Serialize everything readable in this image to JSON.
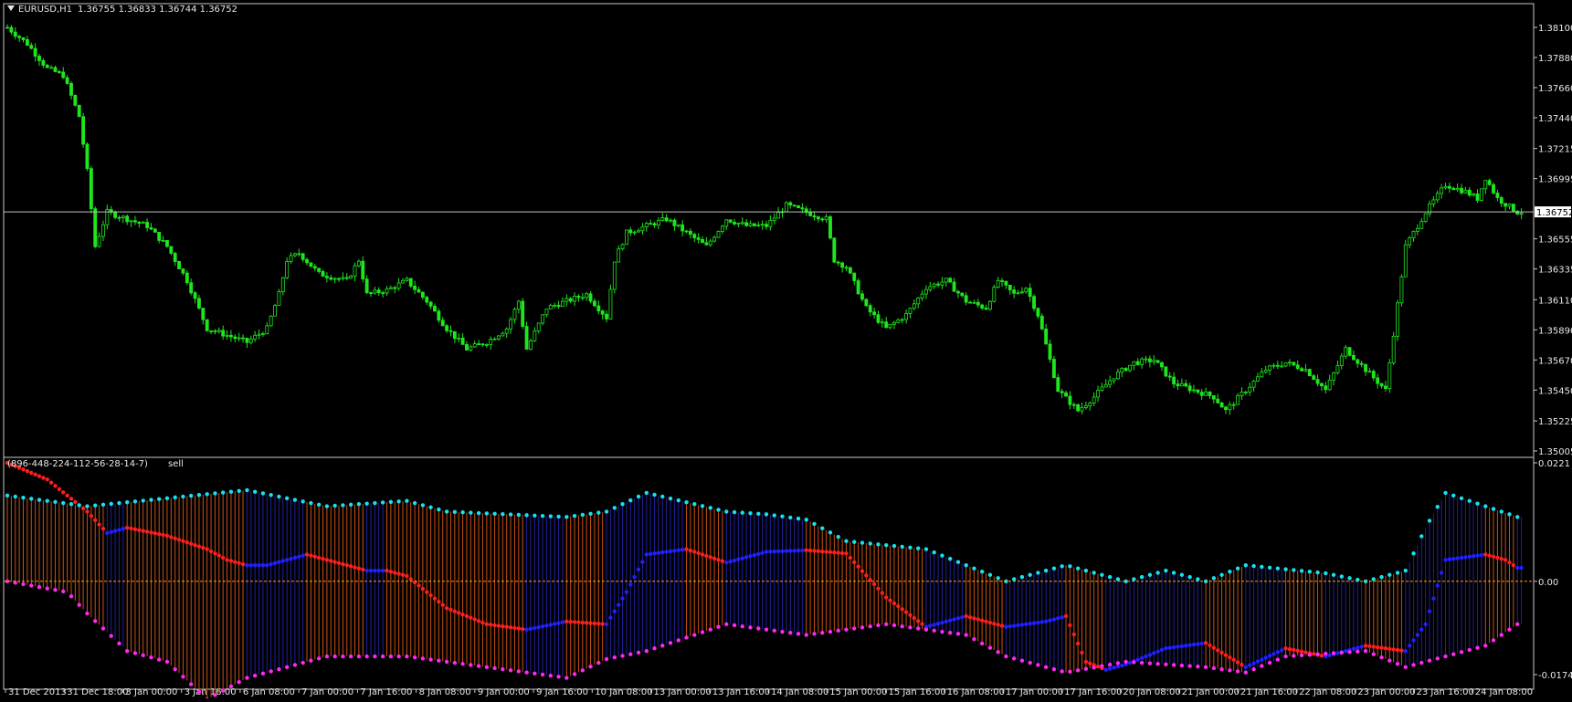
{
  "header": {
    "symbol": "EURUSD,H1",
    "open": "1.36755",
    "high": "1.36833",
    "low": "1.36744",
    "close": "1.36752"
  },
  "indicator": {
    "params": "(896-448-224-112-56-28-14-7)",
    "signal": "sell"
  },
  "colors": {
    "background": "#000000",
    "candle": "#1ee61e",
    "bid_line": "#c0c0c0",
    "zero_line": "#ffa000",
    "red": "#ff1e1e",
    "blue": "#2020ff",
    "cyan": "#18e0f0",
    "magenta": "#ff28f0",
    "hist_red": "#c85014",
    "hist_blue": "#2020a0"
  },
  "chart_data": [
    {
      "type": "candlestick",
      "symbol": "EURUSD",
      "timeframe": "H1",
      "y_ticks": [
        "1.38100",
        "1.37880",
        "1.37660",
        "1.37440",
        "1.37215",
        "1.36995",
        "1.36555",
        "1.36335",
        "1.36110",
        "1.35890",
        "1.35670",
        "1.35450",
        "1.35225",
        "1.35005"
      ],
      "ylim": [
        1.35005,
        1.381
      ],
      "last_price": "1.36752",
      "x_ticks": [
        "31 Dec 2013",
        "31 Dec 18:00",
        "3 Jan 00:00",
        "3 Jan 16:00",
        "6 Jan 08:00",
        "7 Jan 00:00",
        "7 Jan 16:00",
        "8 Jan 08:00",
        "9 Jan 00:00",
        "9 Jan 16:00",
        "10 Jan 08:00",
        "13 Jan 00:00",
        "13 Jan 16:00",
        "14 Jan 08:00",
        "15 Jan 00:00",
        "15 Jan 16:00",
        "16 Jan 08:00",
        "17 Jan 00:00",
        "17 Jan 16:00",
        "20 Jan 08:00",
        "21 Jan 00:00",
        "21 Jan 16:00",
        "22 Jan 08:00",
        "23 Jan 00:00",
        "23 Jan 16:00",
        "24 Jan 08:00"
      ],
      "close_path": [
        [
          0,
          1.381
        ],
        [
          5,
          1.3798
        ],
        [
          10,
          1.378
        ],
        [
          14,
          1.3775
        ],
        [
          18,
          1.3745
        ],
        [
          20,
          1.3705
        ],
        [
          22,
          1.365
        ],
        [
          25,
          1.3675
        ],
        [
          30,
          1.367
        ],
        [
          35,
          1.3665
        ],
        [
          40,
          1.365
        ],
        [
          45,
          1.3625
        ],
        [
          50,
          1.359
        ],
        [
          55,
          1.3585
        ],
        [
          60,
          1.358
        ],
        [
          65,
          1.359
        ],
        [
          68,
          1.3615
        ],
        [
          70,
          1.364
        ],
        [
          73,
          1.3645
        ],
        [
          78,
          1.363
        ],
        [
          85,
          1.3625
        ],
        [
          88,
          1.364
        ],
        [
          90,
          1.3615
        ],
        [
          95,
          1.3618
        ],
        [
          100,
          1.3625
        ],
        [
          105,
          1.361
        ],
        [
          110,
          1.359
        ],
        [
          115,
          1.3575
        ],
        [
          120,
          1.358
        ],
        [
          125,
          1.359
        ],
        [
          128,
          1.361
        ],
        [
          130,
          1.3575
        ],
        [
          135,
          1.3605
        ],
        [
          140,
          1.361
        ],
        [
          145,
          1.3615
        ],
        [
          150,
          1.3598
        ],
        [
          152,
          1.364
        ],
        [
          155,
          1.366
        ],
        [
          160,
          1.3665
        ],
        [
          165,
          1.367
        ],
        [
          170,
          1.366
        ],
        [
          175,
          1.365
        ],
        [
          180,
          1.367
        ],
        [
          185,
          1.3665
        ],
        [
          190,
          1.3665
        ],
        [
          195,
          1.368
        ],
        [
          200,
          1.3675
        ],
        [
          205,
          1.367
        ],
        [
          207,
          1.364
        ],
        [
          210,
          1.3635
        ],
        [
          215,
          1.3605
        ],
        [
          220,
          1.359
        ],
        [
          225,
          1.36
        ],
        [
          230,
          1.362
        ],
        [
          235,
          1.3625
        ],
        [
          240,
          1.361
        ],
        [
          245,
          1.3605
        ],
        [
          248,
          1.3625
        ],
        [
          252,
          1.3615
        ],
        [
          255,
          1.362
        ],
        [
          258,
          1.36
        ],
        [
          263,
          1.3545
        ],
        [
          268,
          1.353
        ],
        [
          272,
          1.354
        ],
        [
          277,
          1.3555
        ],
        [
          282,
          1.3565
        ],
        [
          287,
          1.3567
        ],
        [
          292,
          1.355
        ],
        [
          297,
          1.3545
        ],
        [
          302,
          1.354
        ],
        [
          305,
          1.353
        ],
        [
          310,
          1.3545
        ],
        [
          315,
          1.356
        ],
        [
          320,
          1.3565
        ],
        [
          325,
          1.356
        ],
        [
          330,
          1.3545
        ],
        [
          335,
          1.3575
        ],
        [
          340,
          1.356
        ],
        [
          345,
          1.3545
        ],
        [
          340,
          1.356
        ],
        [
          346,
          1.3565
        ],
        [
          350,
          1.365
        ],
        [
          355,
          1.3675
        ],
        [
          360,
          1.3695
        ],
        [
          365,
          1.369
        ],
        [
          368,
          1.3685
        ],
        [
          370,
          1.37
        ],
        [
          373,
          1.3685
        ],
        [
          378,
          1.3675
        ]
      ]
    },
    {
      "type": "line",
      "y_ticks": [
        "0.0221",
        "0.00",
        "-0.0174"
      ],
      "ylim": [
        -0.0174,
        0.0221
      ],
      "series": [
        {
          "style": "dots-red-blue",
          "points": [
            [
              0,
              0.0221
            ],
            [
              10,
              0.019
            ],
            [
              20,
              0.013
            ],
            [
              25,
              0.009
            ],
            [
              30,
              0.01
            ],
            [
              40,
              0.0085
            ],
            [
              50,
              0.006
            ],
            [
              55,
              0.004
            ],
            [
              60,
              0.003
            ],
            [
              65,
              0.003
            ],
            [
              70,
              0.004
            ],
            [
              75,
              0.005
            ],
            [
              80,
              0.004
            ],
            [
              85,
              0.003
            ],
            [
              90,
              0.002
            ],
            [
              95,
              0.002
            ],
            [
              100,
              0.001
            ],
            [
              110,
              -0.005
            ],
            [
              120,
              -0.008
            ],
            [
              130,
              -0.009
            ],
            [
              140,
              -0.0075
            ],
            [
              150,
              -0.008
            ],
            [
              155,
              -0.002
            ],
            [
              160,
              0.005
            ],
            [
              170,
              0.006
            ],
            [
              180,
              0.0035
            ],
            [
              190,
              0.0055
            ],
            [
              200,
              0.0058
            ],
            [
              210,
              0.0052
            ],
            [
              220,
              -0.003
            ],
            [
              230,
              -0.0085
            ],
            [
              240,
              -0.0065
            ],
            [
              250,
              -0.0085
            ],
            [
              260,
              -0.0075
            ],
            [
              265,
              -0.0065
            ],
            [
              270,
              -0.015
            ],
            [
              275,
              -0.0165
            ],
            [
              280,
              -0.0155
            ],
            [
              290,
              -0.0125
            ],
            [
              300,
              -0.0115
            ],
            [
              310,
              -0.016
            ],
            [
              320,
              -0.0125
            ],
            [
              330,
              -0.014
            ],
            [
              340,
              -0.012
            ],
            [
              350,
              -0.013
            ],
            [
              355,
              -0.008
            ],
            [
              360,
              0.004
            ],
            [
              370,
              0.005
            ],
            [
              375,
              0.004
            ],
            [
              378,
              0.0025
            ]
          ]
        },
        {
          "style": "dots-cyan",
          "points": [
            [
              0,
              0.016
            ],
            [
              20,
              0.014
            ],
            [
              60,
              0.017
            ],
            [
              80,
              0.014
            ],
            [
              100,
              0.015
            ],
            [
              110,
              0.013
            ],
            [
              140,
              0.012
            ],
            [
              150,
              0.013
            ],
            [
              160,
              0.0165
            ],
            [
              180,
              0.013
            ],
            [
              190,
              0.0125
            ],
            [
              200,
              0.0115
            ],
            [
              210,
              0.0075
            ],
            [
              230,
              0.006
            ],
            [
              250,
              0.0
            ],
            [
              265,
              0.003
            ],
            [
              280,
              0.0
            ],
            [
              290,
              0.002
            ],
            [
              300,
              0.0
            ],
            [
              310,
              0.003
            ],
            [
              330,
              0.0015
            ],
            [
              340,
              0.0
            ],
            [
              350,
              0.002
            ],
            [
              355,
              0.01
            ],
            [
              360,
              0.0165
            ],
            [
              370,
              0.014
            ],
            [
              378,
              0.012
            ]
          ]
        },
        {
          "style": "dots-magenta",
          "points": [
            [
              0,
              0.0
            ],
            [
              15,
              -0.002
            ],
            [
              20,
              -0.006
            ],
            [
              30,
              -0.013
            ],
            [
              40,
              -0.015
            ],
            [
              50,
              -0.022
            ],
            [
              60,
              -0.018
            ],
            [
              80,
              -0.014
            ],
            [
              100,
              -0.014
            ],
            [
              120,
              -0.016
            ],
            [
              140,
              -0.018
            ],
            [
              150,
              -0.0145
            ],
            [
              160,
              -0.013
            ],
            [
              180,
              -0.008
            ],
            [
              200,
              -0.01
            ],
            [
              210,
              -0.009
            ],
            [
              220,
              -0.008
            ],
            [
              240,
              -0.01
            ],
            [
              250,
              -0.014
            ],
            [
              265,
              -0.017
            ],
            [
              280,
              -0.015
            ],
            [
              300,
              -0.016
            ],
            [
              310,
              -0.017
            ],
            [
              320,
              -0.014
            ],
            [
              330,
              -0.0135
            ],
            [
              340,
              -0.013
            ],
            [
              350,
              -0.016
            ],
            [
              360,
              -0.014
            ],
            [
              370,
              -0.012
            ],
            [
              378,
              -0.008
            ]
          ]
        }
      ]
    }
  ]
}
